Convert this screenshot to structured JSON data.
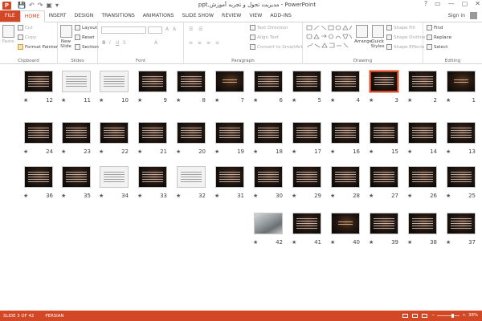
{
  "window": {
    "title": "ppt.مدیریت تحول و تجربه آموزش - PowerPoint",
    "app_icon": "P",
    "controls": [
      "?",
      "▭",
      "—",
      "▢",
      "✕"
    ]
  },
  "qat": [
    "💾",
    "↶",
    "↷",
    "▣",
    "▾"
  ],
  "tabs": {
    "file": "FILE",
    "items": [
      "HOME",
      "INSERT",
      "DESIGN",
      "TRANSITIONS",
      "ANIMATIONS",
      "SLIDE SHOW",
      "REVIEW",
      "VIEW",
      "ADD-INS"
    ],
    "active": "HOME",
    "sign_in": "Sign in"
  },
  "ribbon": {
    "clipboard": {
      "label": "Clipboard",
      "paste": "Paste",
      "cut": "Cut",
      "copy": "Copy",
      "format_painter": "Format Painter"
    },
    "slides": {
      "label": "Slides",
      "new_slide": "New Slide",
      "layout": "Layout",
      "reset": "Reset",
      "section": "Section"
    },
    "font": {
      "label": "Font"
    },
    "paragraph": {
      "label": "Paragraph",
      "text_direction": "Text Direction",
      "align_text": "Align Text",
      "convert_smartart": "Convert to SmartArt"
    },
    "drawing": {
      "label": "Drawing",
      "arrange": "Arrange",
      "quick_styles": "Quick Styles",
      "shape_fill": "Shape Fill",
      "shape_outline": "Shape Outline",
      "shape_effects": "Shape Effects"
    },
    "editing": {
      "label": "Editing",
      "find": "Find",
      "replace": "Replace",
      "select": "Select"
    }
  },
  "status": {
    "slide_info": "SLIDE 3 OF 42",
    "language": "PERSIAN",
    "zoom": "38%"
  },
  "slides": {
    "star": "★",
    "selected": 3,
    "rows": [
      [
        {
          "n": "12",
          "t": "dark"
        },
        {
          "n": "11",
          "t": "light"
        },
        {
          "n": "10",
          "t": "light"
        },
        {
          "n": "9",
          "t": "dark"
        },
        {
          "n": "8",
          "t": "dark"
        },
        {
          "n": "7",
          "t": "title"
        },
        {
          "n": "6",
          "t": "dark"
        },
        {
          "n": "5",
          "t": "dark"
        },
        {
          "n": "4",
          "t": "dark"
        },
        {
          "n": "3",
          "t": "dark"
        },
        {
          "n": "2",
          "t": "dark"
        },
        {
          "n": "1",
          "t": "title"
        }
      ],
      [
        {
          "n": "24",
          "t": "dark"
        },
        {
          "n": "23",
          "t": "dark"
        },
        {
          "n": "22",
          "t": "dark"
        },
        {
          "n": "21",
          "t": "dark"
        },
        {
          "n": "20",
          "t": "dark"
        },
        {
          "n": "19",
          "t": "dark"
        },
        {
          "n": "18",
          "t": "dark"
        },
        {
          "n": "17",
          "t": "dark"
        },
        {
          "n": "16",
          "t": "dark"
        },
        {
          "n": "15",
          "t": "dark"
        },
        {
          "n": "14",
          "t": "dark"
        },
        {
          "n": "13",
          "t": "dark"
        }
      ],
      [
        {
          "n": "36",
          "t": "dark"
        },
        {
          "n": "35",
          "t": "dark"
        },
        {
          "n": "34",
          "t": "light"
        },
        {
          "n": "33",
          "t": "dark"
        },
        {
          "n": "32",
          "t": "light"
        },
        {
          "n": "31",
          "t": "dark"
        },
        {
          "n": "30",
          "t": "dark"
        },
        {
          "n": "29",
          "t": "dark"
        },
        {
          "n": "28",
          "t": "dark"
        },
        {
          "n": "27",
          "t": "dark"
        },
        {
          "n": "26",
          "t": "dark"
        },
        {
          "n": "25",
          "t": "dark"
        }
      ],
      [
        {
          "n": "42",
          "t": "photo"
        },
        {
          "n": "41",
          "t": "dark"
        },
        {
          "n": "40",
          "t": "title"
        },
        {
          "n": "39",
          "t": "dark"
        },
        {
          "n": "38",
          "t": "dark"
        },
        {
          "n": "37",
          "t": "dark"
        }
      ]
    ]
  }
}
